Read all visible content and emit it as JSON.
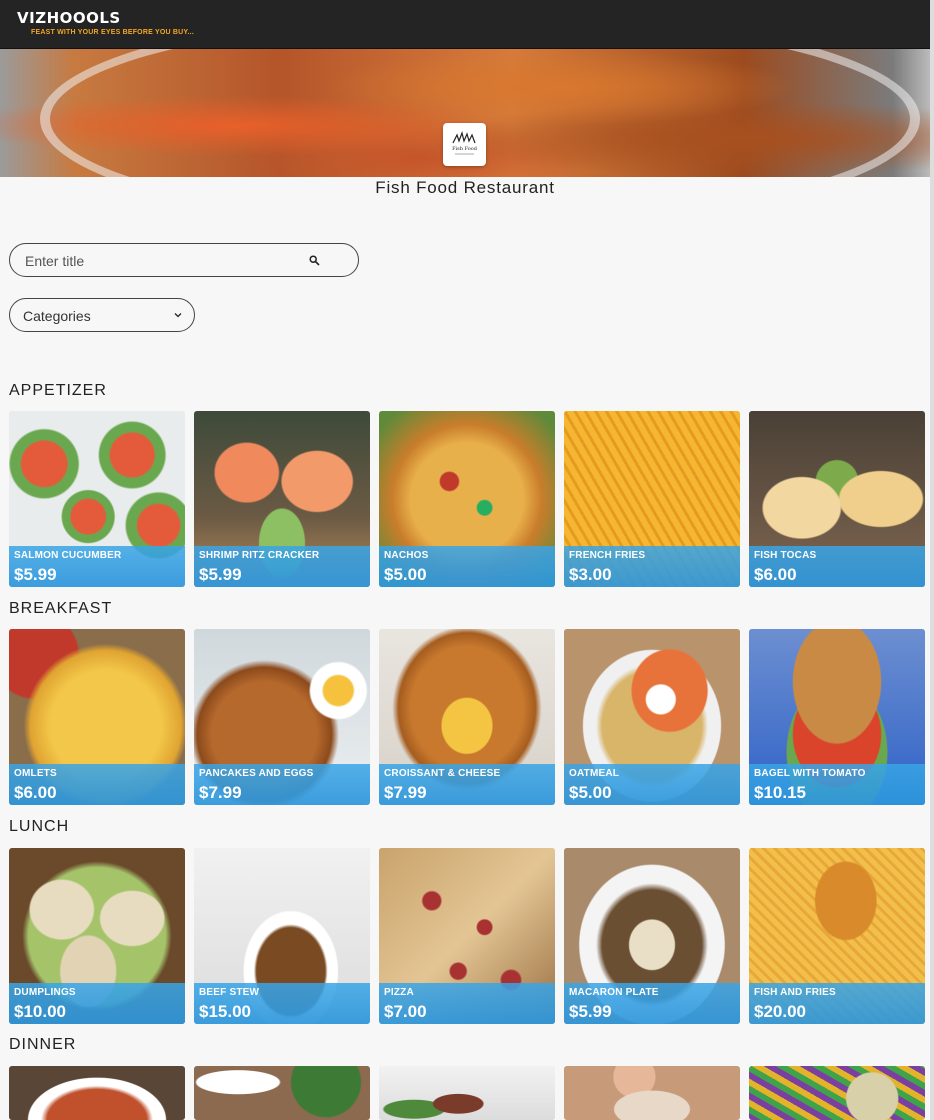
{
  "header": {
    "logo": "VIZHOOOLS",
    "tagline": "FEAST WITH YOUR EYES BEFORE YOU BUY..."
  },
  "restaurant": {
    "name": "Fish Food Restaurant",
    "logo_text": "Fish Food"
  },
  "search": {
    "placeholder": "Enter title",
    "value": ""
  },
  "categories_dropdown": {
    "label": "Categories"
  },
  "sections": [
    {
      "title": "APPETIZER",
      "items": [
        {
          "name": "SALMON CUCUMBER",
          "price": "$5.99"
        },
        {
          "name": "SHRIMP RITZ CRACKER",
          "price": "$5.99"
        },
        {
          "name": "NACHOS",
          "price": "$5.00"
        },
        {
          "name": "FRENCH FRIES",
          "price": "$3.00"
        },
        {
          "name": "FISH TOCAS",
          "price": "$6.00"
        }
      ]
    },
    {
      "title": "BREAKFAST",
      "items": [
        {
          "name": "OMLETS",
          "price": "$6.00"
        },
        {
          "name": "PANCAKES AND EGGS",
          "price": "$7.99"
        },
        {
          "name": "CROISSANT & CHEESE",
          "price": "$7.99"
        },
        {
          "name": "OATMEAL",
          "price": "$5.00"
        },
        {
          "name": "BAGEL WITH TOMATO",
          "price": "$10.15"
        }
      ]
    },
    {
      "title": "LUNCH",
      "items": [
        {
          "name": "DUMPLINGS",
          "price": "$10.00"
        },
        {
          "name": "BEEF STEW",
          "price": "$15.00"
        },
        {
          "name": "PIZZA",
          "price": "$7.00"
        },
        {
          "name": "MACARON PLATE",
          "price": "$5.99"
        },
        {
          "name": "FISH AND FRIES",
          "price": "$20.00"
        }
      ]
    },
    {
      "title": "DINNER",
      "items": []
    }
  ],
  "colors": {
    "topbar": "#242424",
    "tagline": "#f5a623",
    "card_overlay": "#3aa5e6"
  }
}
